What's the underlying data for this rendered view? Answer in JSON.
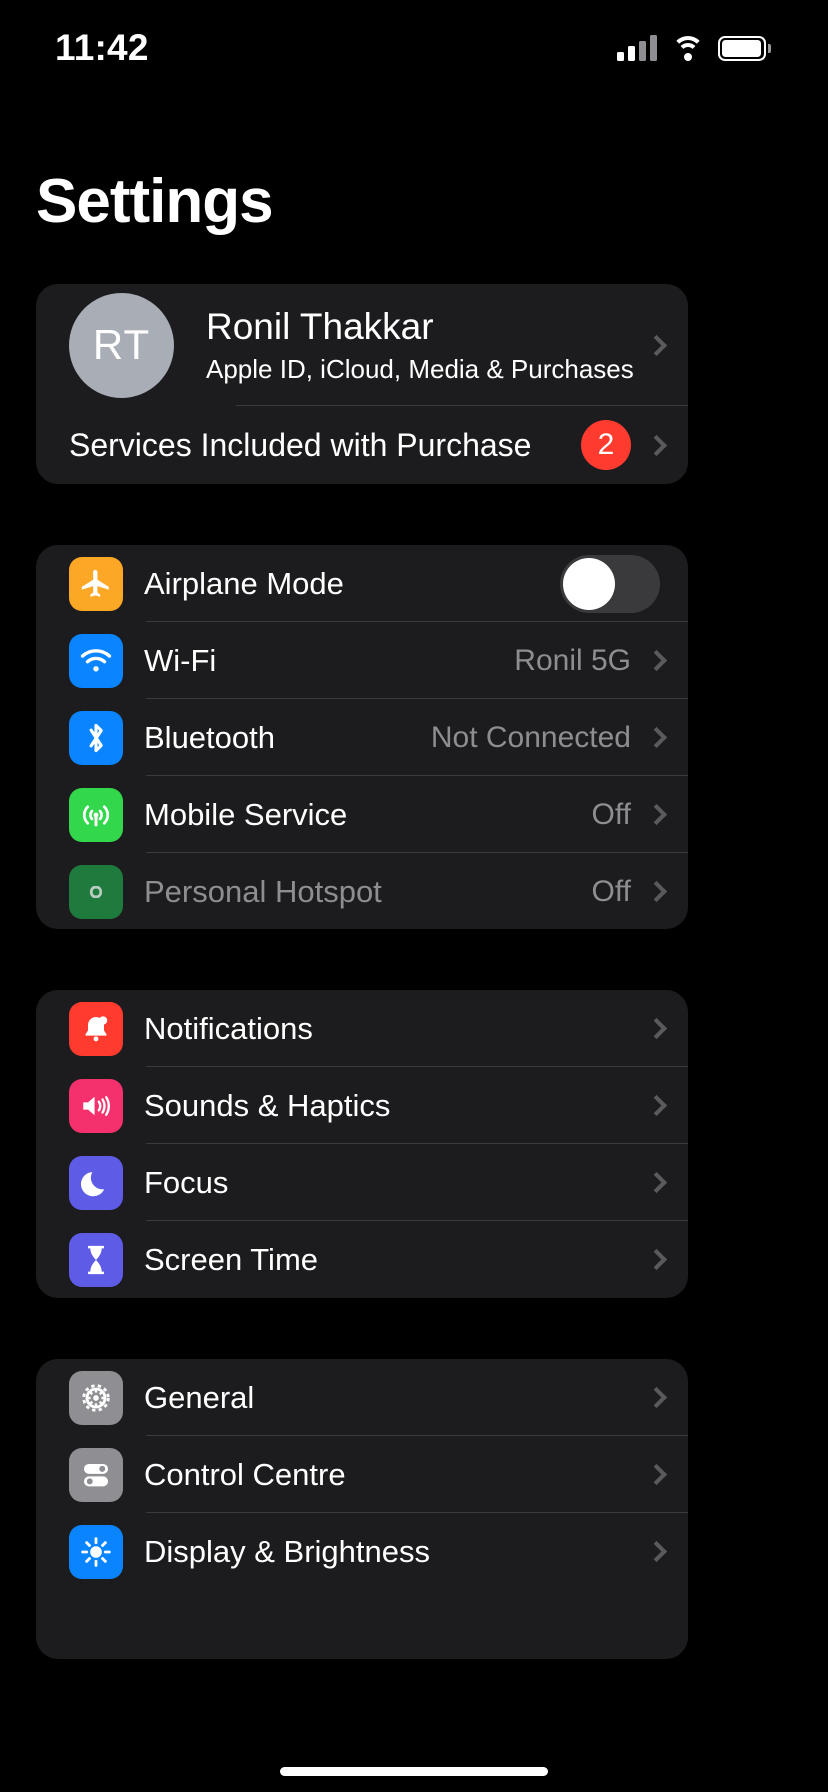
{
  "status_bar": {
    "time": "11:42",
    "cellular_icon": "cellular-bars-icon",
    "wifi_icon": "wifi-icon",
    "battery_icon": "battery-icon"
  },
  "header": {
    "title": "Settings"
  },
  "profile": {
    "avatar_initials": "RT",
    "name": "Ronil Thakkar",
    "subtitle": "Apple ID, iCloud, Media & Purchases",
    "services_label": "Services Included with Purchase",
    "services_badge": "2",
    "badge_color": "#ff3b30"
  },
  "groups": [
    {
      "name": "connectivity",
      "rows": [
        {
          "label": "Airplane Mode",
          "icon": "airplane-icon",
          "value": "",
          "control": "toggle",
          "toggle_on": false,
          "dimmed": false
        },
        {
          "label": "Wi-Fi",
          "icon": "wifi-icon",
          "value": "Ronil 5G",
          "control": "chevron",
          "dimmed": false
        },
        {
          "label": "Bluetooth",
          "icon": "bluetooth-icon",
          "value": "Not Connected",
          "control": "chevron",
          "dimmed": false
        },
        {
          "label": "Mobile Service",
          "icon": "cellular-signal-icon",
          "value": "Off",
          "control": "chevron",
          "dimmed": false
        },
        {
          "label": "Personal Hotspot",
          "icon": "hotspot-link-icon",
          "value": "Off",
          "control": "chevron",
          "dimmed": true
        }
      ]
    },
    {
      "name": "notifications",
      "rows": [
        {
          "label": "Notifications",
          "icon": "bell-icon",
          "value": "",
          "control": "chevron",
          "dimmed": false
        },
        {
          "label": "Sounds & Haptics",
          "icon": "speaker-icon",
          "value": "",
          "control": "chevron",
          "dimmed": false
        },
        {
          "label": "Focus",
          "icon": "moon-icon",
          "value": "",
          "control": "chevron",
          "dimmed": false
        },
        {
          "label": "Screen Time",
          "icon": "hourglass-icon",
          "value": "",
          "control": "chevron",
          "dimmed": false
        }
      ]
    },
    {
      "name": "general",
      "rows": [
        {
          "label": "General",
          "icon": "gear-icon",
          "value": "",
          "control": "chevron",
          "dimmed": false
        },
        {
          "label": "Control Centre",
          "icon": "sliders-icon",
          "value": "",
          "control": "chevron",
          "dimmed": false
        },
        {
          "label": "Display & Brightness",
          "icon": "sun-icon",
          "value": "",
          "control": "chevron",
          "dimmed": false
        }
      ]
    }
  ],
  "colors": {
    "background": "#000000",
    "card": "#1c1c1e",
    "separator": "#3a3a3c",
    "secondary_text": "#8d8d92",
    "accent_red": "#ff3b30",
    "accent_blue": "#0a84ff",
    "accent_green": "#32d74b",
    "accent_purple": "#5e5ce6"
  }
}
